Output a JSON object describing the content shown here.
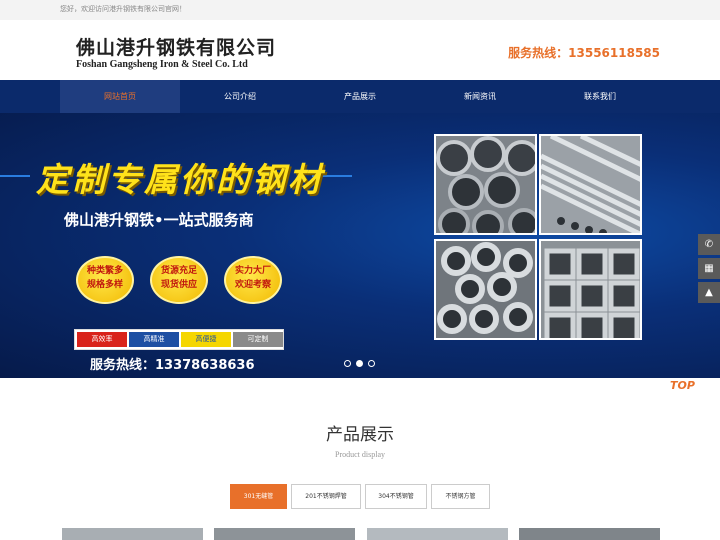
{
  "topbar": {
    "welcome": "您好，欢迎访问港升钢铁有限公司官网！"
  },
  "header": {
    "company_cn": "佛山港升钢铁有限公司",
    "company_en": "Foshan Gangsheng Iron & Steel Co. Ltd",
    "hotline": "服务热线：13556118585"
  },
  "nav": {
    "items": [
      "网站首页",
      "公司介绍",
      "产品展示",
      "新闻资讯",
      "联系我们"
    ],
    "active": 0
  },
  "banner": {
    "title": "定制专属你的钢材",
    "subtitle": "佛山港升钢铁•一站式服务商",
    "badges": [
      {
        "line1": "种类繁多",
        "line2": "规格多样"
      },
      {
        "line1": "货源充足",
        "line2": "现货供应"
      },
      {
        "line1": "实力大厂",
        "line2": "欢迎考察"
      }
    ],
    "tags": [
      {
        "label": "高效率",
        "color": "#d9231b"
      },
      {
        "label": "高精准",
        "color": "#1d4fa3"
      },
      {
        "label": "高便捷",
        "color": "#f5d600"
      },
      {
        "label": "可定制",
        "color": "#8a8a8a"
      }
    ],
    "phone": "服务热线：13378638636",
    "photos": [
      "steel-pipe-stack-photo",
      "steel-tube-bundle-photo",
      "round-pipe-ends-photo",
      "square-tube-stack-photo"
    ],
    "slide_count": 3,
    "active_slide": 1
  },
  "float_buttons": [
    "phone-icon",
    "qrcode-icon",
    "back-to-top-icon"
  ],
  "top_logo": "TOP",
  "products": {
    "title": "产品展示",
    "subtitle": "Product display",
    "tabs": [
      "301无缝管",
      "201不锈钢焊管",
      "304不锈钢管",
      "不锈钢方管"
    ],
    "active_tab": 0
  },
  "colors": {
    "accent": "#e8702a",
    "nav": "#0b2a6b",
    "banner_yellow": "#ffe21a"
  }
}
